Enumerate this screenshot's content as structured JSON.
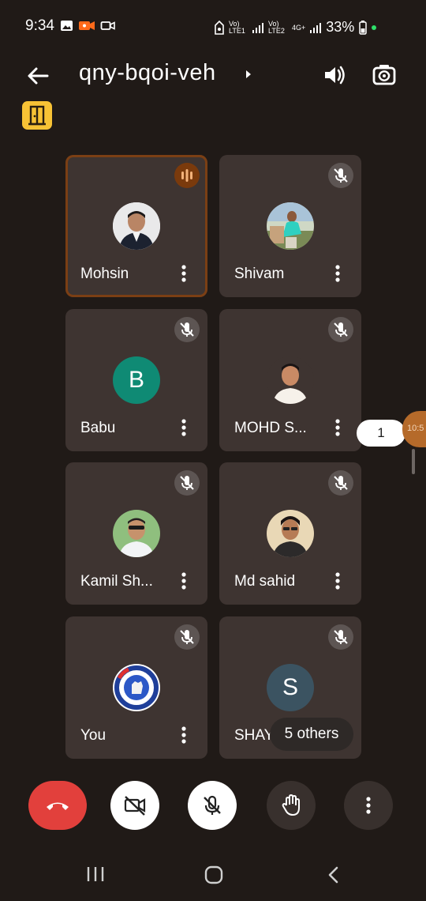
{
  "status_bar": {
    "time": "9:34",
    "sim1": "Vo) LTE1",
    "sim2": "Vo) LTE2",
    "net": "4G+",
    "battery": "33%"
  },
  "header": {
    "title": "qny-bqoi-veh"
  },
  "tiles": [
    {
      "name": "Mohsin",
      "state": "speaking"
    },
    {
      "name": "Shivam",
      "state": "muted"
    },
    {
      "name": "Babu",
      "state": "muted",
      "initial": "B",
      "color": "#0f8a74"
    },
    {
      "name": "MOHD S...",
      "state": "muted"
    },
    {
      "name": "Kamil Sh...",
      "state": "muted"
    },
    {
      "name": "Md sahid",
      "state": "muted"
    },
    {
      "name": "You",
      "state": "muted"
    },
    {
      "name": "SHAYA",
      "state": "muted",
      "initial": "S",
      "color": "#3b5361"
    }
  ],
  "side": {
    "page_number": "1",
    "handle_label": "10:5"
  },
  "others_chip": "5 others",
  "colors": {
    "background": "#201a17",
    "tile": "#3e3431",
    "end_call": "#e2403c",
    "badge_yellow": "#f7c235"
  }
}
